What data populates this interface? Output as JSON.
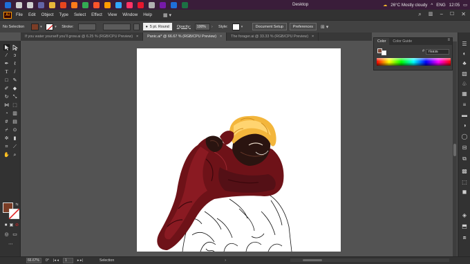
{
  "taskbar": {
    "desktop_label": "Desktop",
    "weather": "26°C  Mostly cloudy",
    "language": "ENG",
    "time": "12:05",
    "app_icons": [
      {
        "name": "windows-start-icon",
        "color": "#1e6fd9"
      },
      {
        "name": "search-icon",
        "color": "#cfcfcf"
      },
      {
        "name": "task-view-icon",
        "color": "#cfcfcf"
      },
      {
        "name": "teams-icon",
        "color": "#6264a7"
      },
      {
        "name": "file-explorer-icon",
        "color": "#e8b53a"
      },
      {
        "name": "media-player-icon",
        "color": "#e8451e"
      },
      {
        "name": "firefox-icon",
        "color": "#ff7a1a"
      },
      {
        "name": "chrome-icon",
        "color": "#34a853"
      },
      {
        "name": "brave-icon",
        "color": "#fb542b"
      },
      {
        "name": "illustrator-icon",
        "color": "#ff9a00"
      },
      {
        "name": "photoshop-icon",
        "color": "#31a8ff"
      },
      {
        "name": "indesign-icon",
        "color": "#ff3366"
      },
      {
        "name": "weibo-icon",
        "color": "#e6162d"
      },
      {
        "name": "settings-icon",
        "color": "#b0b0b0"
      },
      {
        "name": "onenote-icon",
        "color": "#7719aa"
      },
      {
        "name": "store-icon",
        "color": "#1e6fd9"
      },
      {
        "name": "excel-icon",
        "color": "#1d7044"
      }
    ]
  },
  "app": {
    "logo_text": "Ai",
    "menu": [
      "File",
      "Edit",
      "Object",
      "Type",
      "Select",
      "Effect",
      "View",
      "Window",
      "Help"
    ]
  },
  "control_bar": {
    "selection_label": "No Selection",
    "fill_color": "#7b3d26",
    "stroke_label": "Stroke:",
    "brush_label": "5 pt. Round",
    "opacity_label": "Opacity:",
    "opacity_value": "100%",
    "style_label": "Style:",
    "document_setup": "Document Setup",
    "preferences": "Preferences"
  },
  "tabs": [
    {
      "label": "If you water yourself you'll grow.ai @ 6.25 % (RGB/CPU Preview)",
      "active": false
    },
    {
      "label": "Panic.ai* @ 66.67 % (RGB/CPU Preview)",
      "active": true
    },
    {
      "label": "The forager.ai @ 33.33 % (RGB/CPU Preview)",
      "active": false
    }
  ],
  "color_panel": {
    "tab_color": "Color",
    "tab_guide": "Color Guide",
    "hex_symbol": "#",
    "hex_value": "7f4835"
  },
  "status": {
    "zoom": "66.67%",
    "artboard_number": "1",
    "mode": "Selection"
  },
  "colors": {
    "hair": "#f3b63c",
    "jacket": "#6e1218",
    "skin": "#2a1410"
  }
}
